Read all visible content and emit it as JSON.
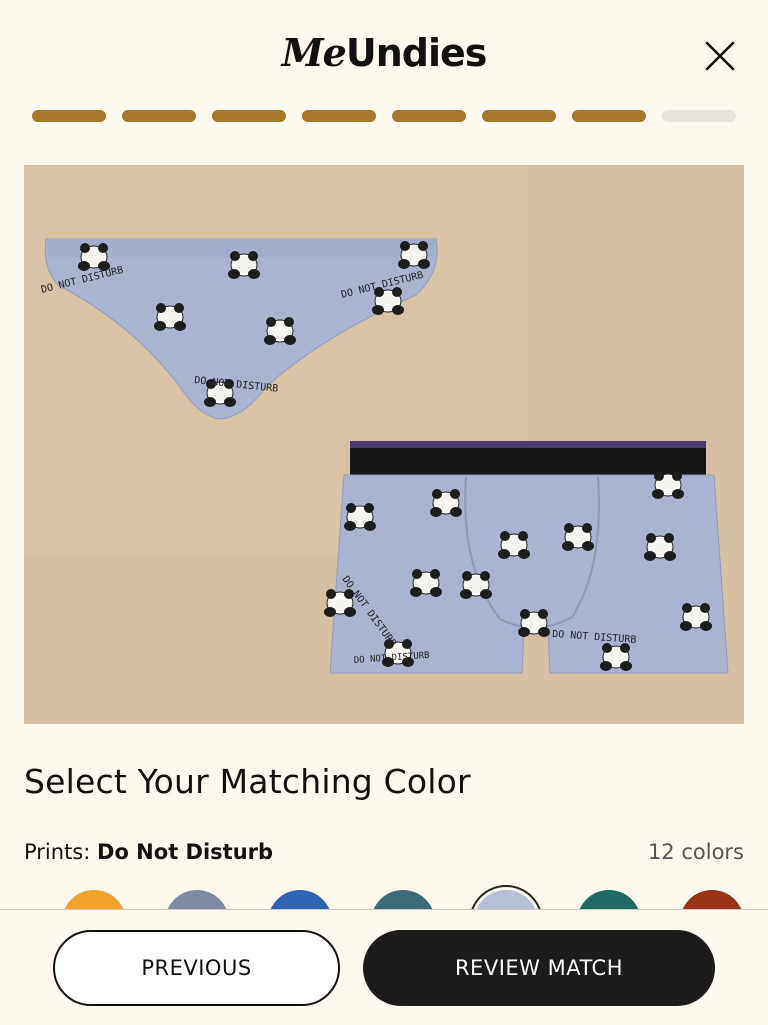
{
  "header": {
    "logo_me": "Me",
    "logo_undies": "Undies",
    "close_icon": "close-icon"
  },
  "progress": {
    "total_steps": 8,
    "completed_steps": 7,
    "filled_color": "#a7772b",
    "empty_color": "#e6e3dc"
  },
  "hero": {
    "background_color": "#d4bfa3",
    "garment_color": "#a9b4d1",
    "print_text": "DO NOT DISTURB",
    "products": [
      "panda-print-bikini-brief",
      "panda-print-trunk"
    ]
  },
  "selection": {
    "title": "Select Your Matching Color",
    "prints_label": "Prints:",
    "print_name": "Do Not Disturb",
    "color_count": "12 colors"
  },
  "swatches": [
    {
      "name": "orange-yellow-print",
      "color": "#f0a22a"
    },
    {
      "name": "gray-panda-print",
      "color": "#7f8aa2"
    },
    {
      "name": "blue-print",
      "color": "#2f63b3"
    },
    {
      "name": "teal-brown-print",
      "color": "#3d6b78"
    },
    {
      "name": "do-not-disturb-print",
      "color": "#b7c0d6",
      "selected": true
    },
    {
      "name": "green-teal-print",
      "color": "#1d6b62"
    },
    {
      "name": "red-brown-print",
      "color": "#9a3419"
    }
  ],
  "footer": {
    "previous_label": "PREVIOUS",
    "review_label": "REVIEW MATCH"
  }
}
